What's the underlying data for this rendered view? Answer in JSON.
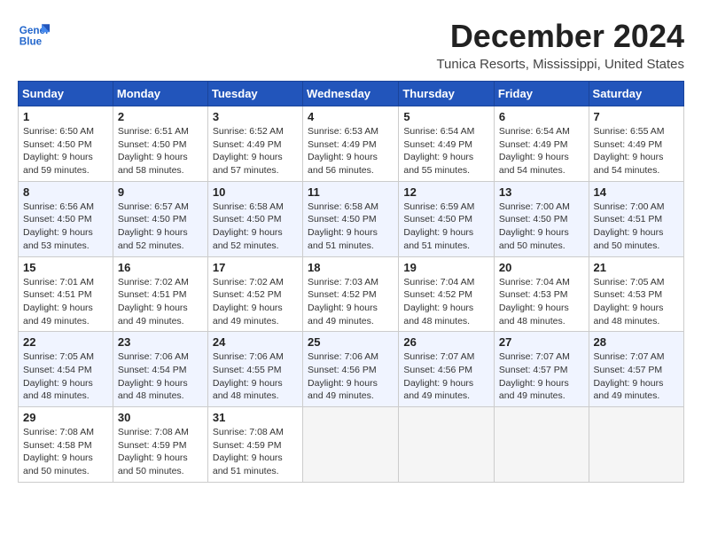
{
  "logo": {
    "line1": "General",
    "line2": "Blue"
  },
  "title": "December 2024",
  "subtitle": "Tunica Resorts, Mississippi, United States",
  "days_of_week": [
    "Sunday",
    "Monday",
    "Tuesday",
    "Wednesday",
    "Thursday",
    "Friday",
    "Saturday"
  ],
  "weeks": [
    [
      {
        "day": "1",
        "sunrise": "6:50 AM",
        "sunset": "4:50 PM",
        "daylight": "9 hours and 59 minutes."
      },
      {
        "day": "2",
        "sunrise": "6:51 AM",
        "sunset": "4:50 PM",
        "daylight": "9 hours and 58 minutes."
      },
      {
        "day": "3",
        "sunrise": "6:52 AM",
        "sunset": "4:49 PM",
        "daylight": "9 hours and 57 minutes."
      },
      {
        "day": "4",
        "sunrise": "6:53 AM",
        "sunset": "4:49 PM",
        "daylight": "9 hours and 56 minutes."
      },
      {
        "day": "5",
        "sunrise": "6:54 AM",
        "sunset": "4:49 PM",
        "daylight": "9 hours and 55 minutes."
      },
      {
        "day": "6",
        "sunrise": "6:54 AM",
        "sunset": "4:49 PM",
        "daylight": "9 hours and 54 minutes."
      },
      {
        "day": "7",
        "sunrise": "6:55 AM",
        "sunset": "4:49 PM",
        "daylight": "9 hours and 54 minutes."
      }
    ],
    [
      {
        "day": "8",
        "sunrise": "6:56 AM",
        "sunset": "4:50 PM",
        "daylight": "9 hours and 53 minutes."
      },
      {
        "day": "9",
        "sunrise": "6:57 AM",
        "sunset": "4:50 PM",
        "daylight": "9 hours and 52 minutes."
      },
      {
        "day": "10",
        "sunrise": "6:58 AM",
        "sunset": "4:50 PM",
        "daylight": "9 hours and 52 minutes."
      },
      {
        "day": "11",
        "sunrise": "6:58 AM",
        "sunset": "4:50 PM",
        "daylight": "9 hours and 51 minutes."
      },
      {
        "day": "12",
        "sunrise": "6:59 AM",
        "sunset": "4:50 PM",
        "daylight": "9 hours and 51 minutes."
      },
      {
        "day": "13",
        "sunrise": "7:00 AM",
        "sunset": "4:50 PM",
        "daylight": "9 hours and 50 minutes."
      },
      {
        "day": "14",
        "sunrise": "7:00 AM",
        "sunset": "4:51 PM",
        "daylight": "9 hours and 50 minutes."
      }
    ],
    [
      {
        "day": "15",
        "sunrise": "7:01 AM",
        "sunset": "4:51 PM",
        "daylight": "9 hours and 49 minutes."
      },
      {
        "day": "16",
        "sunrise": "7:02 AM",
        "sunset": "4:51 PM",
        "daylight": "9 hours and 49 minutes."
      },
      {
        "day": "17",
        "sunrise": "7:02 AM",
        "sunset": "4:52 PM",
        "daylight": "9 hours and 49 minutes."
      },
      {
        "day": "18",
        "sunrise": "7:03 AM",
        "sunset": "4:52 PM",
        "daylight": "9 hours and 49 minutes."
      },
      {
        "day": "19",
        "sunrise": "7:04 AM",
        "sunset": "4:52 PM",
        "daylight": "9 hours and 48 minutes."
      },
      {
        "day": "20",
        "sunrise": "7:04 AM",
        "sunset": "4:53 PM",
        "daylight": "9 hours and 48 minutes."
      },
      {
        "day": "21",
        "sunrise": "7:05 AM",
        "sunset": "4:53 PM",
        "daylight": "9 hours and 48 minutes."
      }
    ],
    [
      {
        "day": "22",
        "sunrise": "7:05 AM",
        "sunset": "4:54 PM",
        "daylight": "9 hours and 48 minutes."
      },
      {
        "day": "23",
        "sunrise": "7:06 AM",
        "sunset": "4:54 PM",
        "daylight": "9 hours and 48 minutes."
      },
      {
        "day": "24",
        "sunrise": "7:06 AM",
        "sunset": "4:55 PM",
        "daylight": "9 hours and 48 minutes."
      },
      {
        "day": "25",
        "sunrise": "7:06 AM",
        "sunset": "4:56 PM",
        "daylight": "9 hours and 49 minutes."
      },
      {
        "day": "26",
        "sunrise": "7:07 AM",
        "sunset": "4:56 PM",
        "daylight": "9 hours and 49 minutes."
      },
      {
        "day": "27",
        "sunrise": "7:07 AM",
        "sunset": "4:57 PM",
        "daylight": "9 hours and 49 minutes."
      },
      {
        "day": "28",
        "sunrise": "7:07 AM",
        "sunset": "4:57 PM",
        "daylight": "9 hours and 49 minutes."
      }
    ],
    [
      {
        "day": "29",
        "sunrise": "7:08 AM",
        "sunset": "4:58 PM",
        "daylight": "9 hours and 50 minutes."
      },
      {
        "day": "30",
        "sunrise": "7:08 AM",
        "sunset": "4:59 PM",
        "daylight": "9 hours and 50 minutes."
      },
      {
        "day": "31",
        "sunrise": "7:08 AM",
        "sunset": "4:59 PM",
        "daylight": "9 hours and 51 minutes."
      },
      null,
      null,
      null,
      null
    ]
  ],
  "labels": {
    "sunrise": "Sunrise:",
    "sunset": "Sunset:",
    "daylight": "Daylight:"
  }
}
